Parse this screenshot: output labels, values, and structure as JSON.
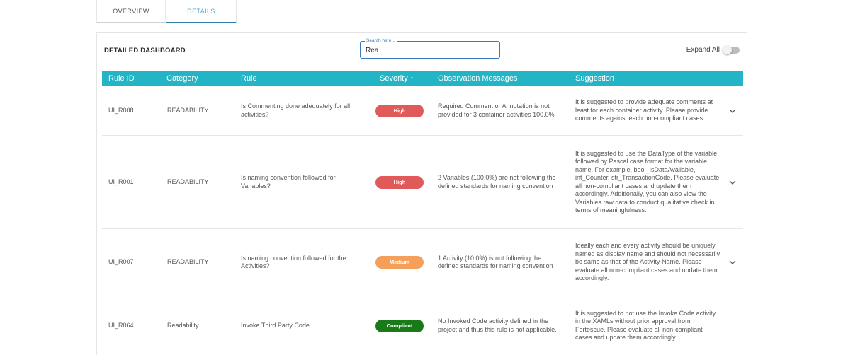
{
  "tabs": [
    {
      "label": "OVERVIEW",
      "active": false
    },
    {
      "label": "DETAILS",
      "active": true
    }
  ],
  "dashboard": {
    "title": "DETAILED DASHBOARD",
    "search": {
      "legend": "Search here...",
      "value": "Rea"
    },
    "expand_all_label": "Expand All",
    "expand_all_on": false
  },
  "table": {
    "headers": {
      "rule_id": "Rule ID",
      "category": "Category",
      "rule": "Rule",
      "severity": "Severity",
      "observation": "Observation Messages",
      "suggestion": "Suggestion"
    },
    "sort": {
      "column": "severity",
      "direction": "ascending",
      "icon": "arrow-up-icon"
    },
    "rows": [
      {
        "rule_id": "UI_R008",
        "category": "READABILITY",
        "rule": "Is Commenting done adequately for all activities?",
        "severity": "High",
        "severity_color": "#e05a5a",
        "observation": "Required Comment or Annotation is not provided for 3 container activities 100.0%",
        "suggestion": "It is suggested to provide adequate comments at least for each container activity. Please provide comments against each non-compliant cases."
      },
      {
        "rule_id": "UI_R001",
        "category": "READABILITY",
        "rule": "Is naming convention followed for Variables?",
        "severity": "High",
        "severity_color": "#e05a5a",
        "observation": "2 Variables (100.0%) are not following the defined standards for naming convention",
        "suggestion": "It is suggested to use the DataType of the variable followed by Pascal case format for the variable name. For example, bool_IsDataAvailable, int_Counter, str_TransactionCode. Please evaluate all non-compliant cases and update them accordingly. Additionally, you can also view the Variables raw data to conduct qualitative check in terms of meaningfulness."
      },
      {
        "rule_id": "UI_R007",
        "category": "READABILITY",
        "rule": "Is naming convention followed for the Activities?",
        "severity": "Medium",
        "severity_color": "#f5a05a",
        "observation": "1 Activity (10.0%) is not following the defined standards for naming convention",
        "suggestion": "Ideally each and every activity should be uniquely named as display name and should not necessarily be same as that of the Activity Name. Please evaluate all non-compliant cases and update them accordingly."
      },
      {
        "rule_id": "UI_R064",
        "category": "Readability",
        "rule": "Invoke Third Party Code",
        "severity": "Compliant",
        "severity_color": "#1a7a1a",
        "observation": "No Invoked Code activity defined in the project and thus this rule is not applicable.",
        "suggestion": "It is suggested to not use the Invoke Code activity in the XAMLs without prior approval from Fortescue. Please evaluate all non-compliant cases and update them accordingly."
      }
    ]
  },
  "colors": {
    "header_bg": "#23b5c6",
    "active_tab_text": "#56a8c8",
    "search_border": "#3b7bbd"
  }
}
